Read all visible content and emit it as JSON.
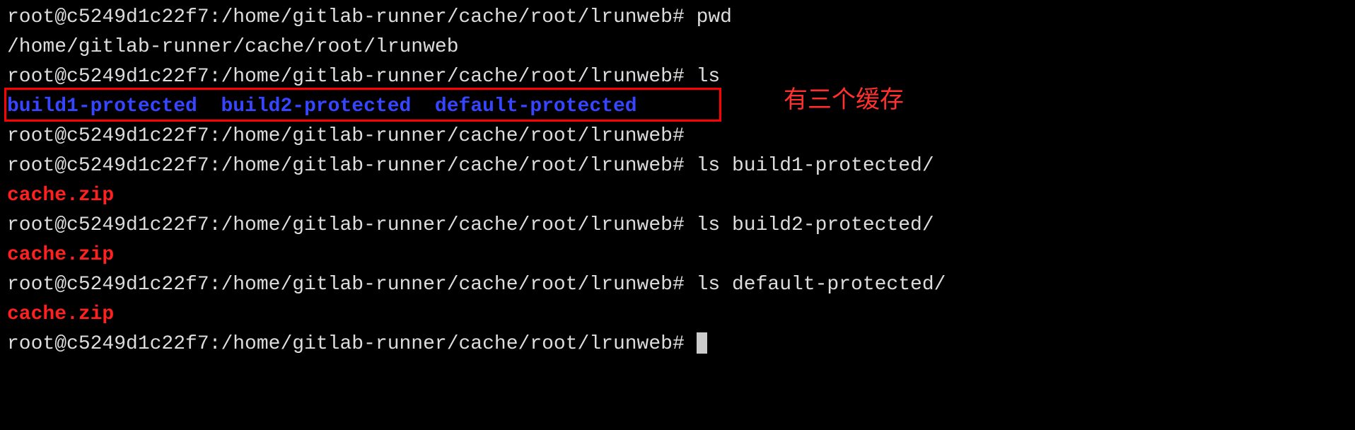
{
  "prompt": "root@c5249d1c22f7:/home/gitlab-runner/cache/root/lrunweb#",
  "lines": {
    "cmd_pwd": "pwd",
    "out_pwd": "/home/gitlab-runner/cache/root/lrunweb",
    "cmd_ls": "ls",
    "ls_item1": "build1-protected",
    "ls_item2": "build2-protected",
    "ls_item3": "default-protected",
    "cmd_ls_b1": "ls build1-protected/",
    "out_cache": "cache.zip",
    "cmd_ls_b2": "ls build2-protected/",
    "cmd_ls_def": "ls default-protected/"
  },
  "annotation": "有三个缓存"
}
